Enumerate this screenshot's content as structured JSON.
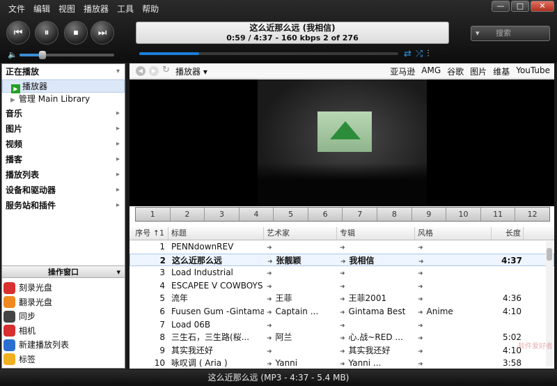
{
  "menu": [
    "文件",
    "编辑",
    "视图",
    "播放器",
    "工具",
    "帮助"
  ],
  "window_controls": [
    "—",
    "□",
    "✕"
  ],
  "transport": {
    "prev": "⏮",
    "pause": "⏸",
    "stop": "⏹",
    "next": "⏭"
  },
  "now_playing": {
    "title": "这么近那么远 (我相信)",
    "info": "0:59 / 4:37 - 160 kbps   2 of 276"
  },
  "search": {
    "label": "搜索",
    "arrow": "▾"
  },
  "volume": {
    "level": 0.24
  },
  "progress": {
    "fraction": 0.23
  },
  "sidebar": {
    "now_playing": "正在播放",
    "player": "播放器",
    "manage": "管理 Main Library",
    "items": [
      "音乐",
      "图片",
      "视频",
      "播客",
      "播放列表",
      "设备和驱动器",
      "服务站和插件"
    ]
  },
  "ops": {
    "header": "操作窗口",
    "items": [
      {
        "label": "刻录光盘",
        "color": "#d83030"
      },
      {
        "label": "翻录光盘",
        "color": "#f08a20"
      },
      {
        "label": "同步",
        "color": "#444444"
      },
      {
        "label": "相机",
        "color": "#d83030"
      },
      {
        "label": "新建播放列表",
        "color": "#2a6fd0"
      },
      {
        "label": "标签",
        "color": "#f0b020"
      }
    ]
  },
  "nav": {
    "crumb": "播放器 ▾",
    "links": [
      "亚马逊",
      "AMG",
      "谷歌",
      "图片",
      "维基",
      "YouTube"
    ]
  },
  "chapters": [
    "1",
    "2",
    "3",
    "4",
    "5",
    "6",
    "7",
    "8",
    "9",
    "10",
    "11",
    "12"
  ],
  "table": {
    "headers": [
      "序号 ↑1",
      "标题",
      "艺术家",
      "专辑",
      "风格",
      "长度"
    ],
    "rows": [
      {
        "num": "1",
        "title": "PENNdownREV",
        "artist": "",
        "album": "",
        "genre": "",
        "length": ""
      },
      {
        "num": "2",
        "title": "这么近那么远",
        "artist": "张靓颖",
        "album": "我相信",
        "genre": "",
        "length": "4:37"
      },
      {
        "num": "3",
        "title": "Load Industrial",
        "artist": "",
        "album": "",
        "genre": "",
        "length": ""
      },
      {
        "num": "4",
        "title": "ESCAPEE V COWBOYS ...",
        "artist": "",
        "album": "",
        "genre": "",
        "length": ""
      },
      {
        "num": "5",
        "title": "流年",
        "artist": "王菲",
        "album": "王菲2001",
        "genre": "",
        "length": "4:36"
      },
      {
        "num": "6",
        "title": "Fuusen Gum -Gintama ...",
        "artist": "Captain ...",
        "album": "Gintama Best",
        "genre": "Anime",
        "length": "4:10"
      },
      {
        "num": "7",
        "title": "Load 06B",
        "artist": "",
        "album": "",
        "genre": "",
        "length": ""
      },
      {
        "num": "8",
        "title": "三生石，三生路(桜...",
        "artist": "阿兰",
        "album": "心.战~RED ...",
        "genre": "",
        "length": "5:02"
      },
      {
        "num": "9",
        "title": "其实我还好",
        "artist": "",
        "album": "其实我还好",
        "genre": "",
        "length": "4:10"
      },
      {
        "num": "10",
        "title": "咏叹调 ( Aria )",
        "artist": "Yanni",
        "album": "Yanni ...",
        "genre": "",
        "length": "3:58"
      }
    ]
  },
  "status": "这么近那么远 (MP3 - 4:37 - 5.4 MB)",
  "watermark": "软件爱好者"
}
